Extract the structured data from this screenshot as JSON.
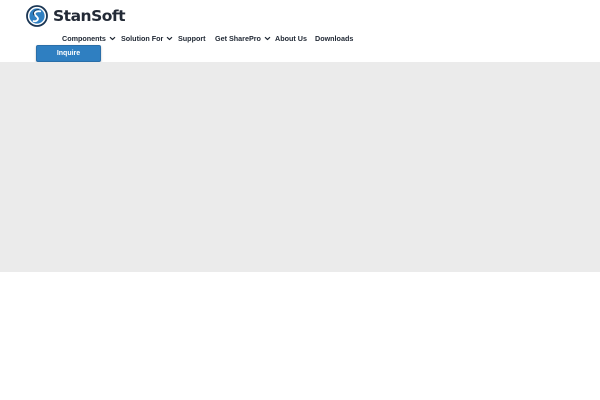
{
  "brand": {
    "name": "StanSoft",
    "logo_icon": "stansoft-logo-icon"
  },
  "nav": {
    "items": [
      {
        "label": "Components",
        "has_dropdown": true
      },
      {
        "label": "Solution For",
        "has_dropdown": true
      },
      {
        "label": "Support",
        "has_dropdown": false
      },
      {
        "label": "Get SharePro",
        "has_dropdown": true
      },
      {
        "label": "About Us",
        "has_dropdown": false
      },
      {
        "label": "Downloads",
        "has_dropdown": false
      }
    ]
  },
  "cta": {
    "label": "Inquire"
  },
  "colors": {
    "accent": "#2f7fc1",
    "text": "#1f2733",
    "hero_background": "#ebebeb",
    "page_background": "#ffffff"
  }
}
